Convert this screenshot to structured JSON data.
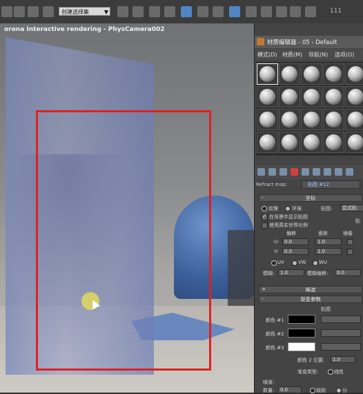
{
  "toolbar": {
    "selection_dropdown": "创建选择集",
    "counter": "111"
  },
  "viewport": {
    "title": "orona Interactive rendering - PhysCamera002"
  },
  "material_editor": {
    "title": "材质编辑器 - 05 - Default",
    "menu": [
      "模式(D)",
      "材质(M)",
      "导航(N)",
      "选项(O)"
    ],
    "slot_count": 24,
    "refract_label": "Refract map:",
    "refract_value": "贴图 #12",
    "coords_rollout": "坐标",
    "texture_radio": "纹理",
    "env_radio": "环境",
    "mapping_label": "贴图:",
    "mapping_value": "显式贴",
    "show_in_bg": "在背景中显示贴图",
    "real_world": "使用真实世界比例",
    "map_side": "贴",
    "offset_label": "偏移",
    "tiling_label": "瓷砖",
    "mirror_label": "镜像",
    "u_label": "U:",
    "v_label": "V:",
    "u_offset": "0.0",
    "v_offset": "0.0",
    "u_tiling": "1.0",
    "v_tiling": "1.0",
    "uv_options": [
      "UV",
      "VW",
      "WU"
    ],
    "blur_label": "模糊:",
    "blur_value": "1.0",
    "blur_offset_label": "模糊偏移:",
    "blur_offset_value": "0.0",
    "noise_rollout": "噪波",
    "gradient_rollout": "渐变参数",
    "map_col": "贴图",
    "color1": "颜色 #1",
    "color2": "颜色 #2",
    "color3": "颜色 #3",
    "color1_hex": "#000000",
    "color2_hex": "#000000",
    "color3_hex": "#ffffff",
    "color2_pos_label": "颜色 2 位置:",
    "color2_pos_value": "1.0",
    "gradient_type_label": "渐变类型:",
    "gradient_type_value": "线性",
    "noise_group": "噪波:",
    "amount_label": "数量:",
    "amount_value": "0.0",
    "noise_regular": "规则",
    "noise_fractal": "分"
  }
}
